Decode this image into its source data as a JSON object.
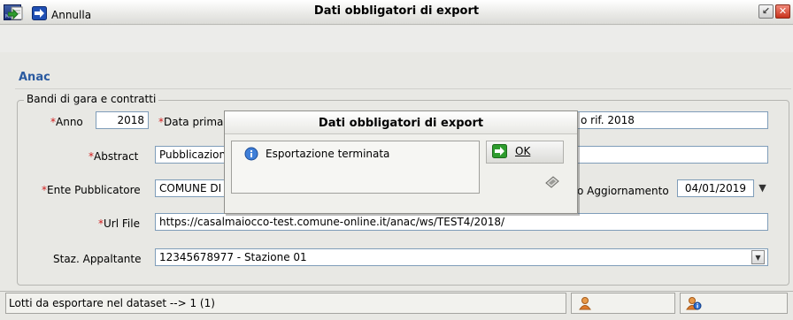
{
  "window": {
    "title": "Dati obbligatori di export",
    "app_icon_text": "Maggioli"
  },
  "toolbar": {
    "cancel_label": "Annulla"
  },
  "section": {
    "title": "Anac"
  },
  "fieldset": {
    "legend": "Bandi di gara e contratti"
  },
  "form": {
    "anno_label": "Anno",
    "anno_value": "2018",
    "data_prima_label": "Data prima",
    "data_prima_value": "",
    "rif_value": "o rif. 2018",
    "abstract_label": "Abstract",
    "abstract_value": "Pubblicazione",
    "ente_label": "Ente Pubblicatore",
    "ente_value": "COMUNE DI",
    "aggiornamento_label": "o Aggiornamento",
    "aggiornamento_value": "04/01/2019",
    "url_label": "Url File",
    "url_value": "https://casalmaiocco-test.comune-online.it/anac/ws/TEST4/2018/",
    "staz_label": "Staz. Appaltante",
    "staz_value": "12345678977 - Stazione 01",
    "required_marker": "*"
  },
  "status": {
    "text": "Lotti da esportare nel dataset --> 1 (1)"
  },
  "dialog": {
    "title": "Dati obbligatori di export",
    "message": "Esportazione terminata",
    "ok_label": "OK"
  },
  "colors": {
    "section_title": "#2a5aa0",
    "required": "#d01c1c",
    "input_border": "#7f9db9"
  }
}
